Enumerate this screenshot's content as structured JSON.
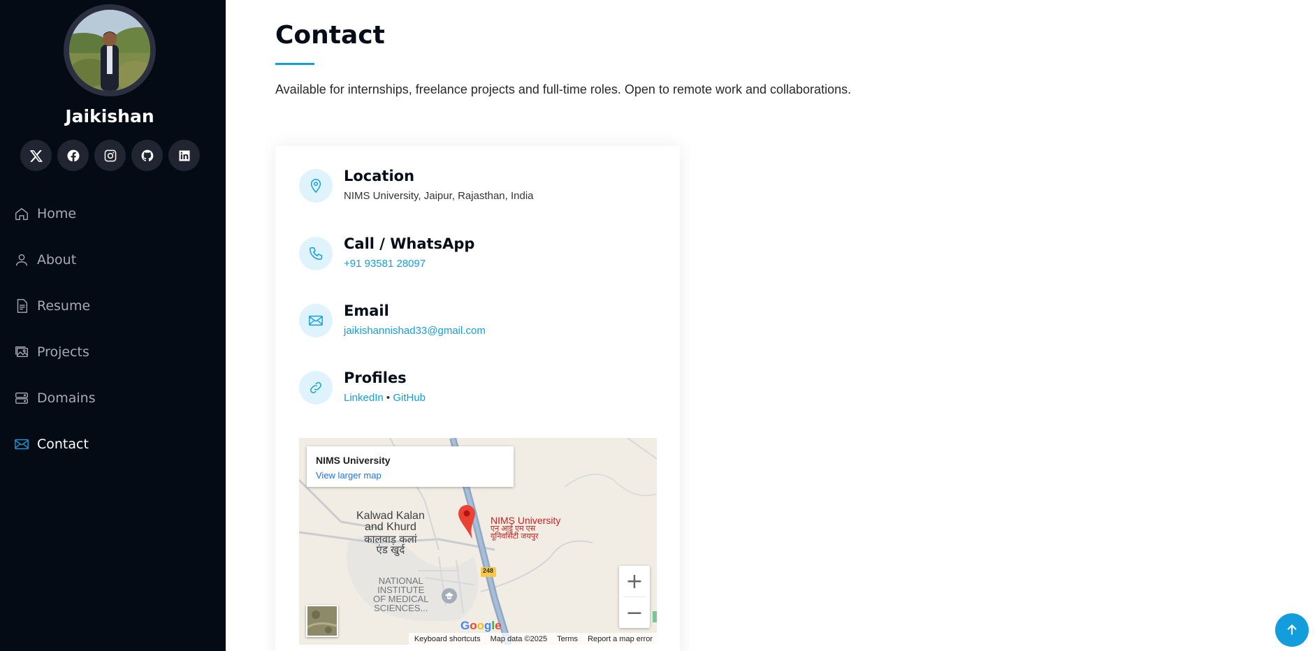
{
  "sidebar": {
    "name": "Jaikishan",
    "socials": [
      {
        "icon": "x-twitter-icon"
      },
      {
        "icon": "facebook-icon"
      },
      {
        "icon": "instagram-icon"
      },
      {
        "icon": "github-icon"
      },
      {
        "icon": "linkedin-icon"
      }
    ],
    "nav": [
      {
        "label": "Home",
        "icon": "house-icon"
      },
      {
        "label": "About",
        "icon": "person-icon"
      },
      {
        "label": "Resume",
        "icon": "file-text-icon"
      },
      {
        "label": "Projects",
        "icon": "images-icon"
      },
      {
        "label": "Domains",
        "icon": "hdd-stack-icon"
      },
      {
        "label": "Contact",
        "icon": "envelope-icon",
        "active": true
      }
    ]
  },
  "main": {
    "title": "Contact",
    "intro": "Available for internships, freelance projects and full-time roles. Open to remote work and collaborations.",
    "info": [
      {
        "title": "Location",
        "text": "NIMS University, Jaipur, Rajasthan, India",
        "icon": "geo-alt-icon"
      },
      {
        "title": "Call / WhatsApp",
        "text": "+91 93581 28097",
        "icon": "telephone-icon"
      },
      {
        "title": "Email",
        "text": "jaikishannishad33@gmail.com",
        "icon": "envelope-icon"
      },
      {
        "title": "Profiles",
        "link1": "LinkedIn",
        "separator": " • ",
        "link2": "GitHub",
        "icon": "link-icon"
      }
    ],
    "map": {
      "place_title": "NIMS University",
      "larger_map": "View larger map",
      "pin_label_en": "NIMS University",
      "pin_label_hi_1": "एन आई एम एस",
      "pin_label_hi_2": "यूनिवर्सिटी जयपुर",
      "area_en_1": "Kalwad Kalan",
      "area_en_2": "and Khurd",
      "area_hi_1": "कालवाड़ कलां",
      "area_hi_2": "एंड खुर्द",
      "inst_1": "NATIONAL",
      "inst_2": "INSTITUTE",
      "inst_3": "OF MEDICAL",
      "inst_4": "SCIENCES...",
      "road": "248",
      "zoom_in": "+",
      "zoom_out": "−",
      "google": "Google",
      "attribution": [
        "Keyboard shortcuts",
        "Map data ©2025",
        "Terms",
        "Report a map error"
      ]
    }
  },
  "colors": {
    "accent": "#149ddd",
    "sidebar_bg": "#040b14",
    "heading": "#050d18"
  }
}
